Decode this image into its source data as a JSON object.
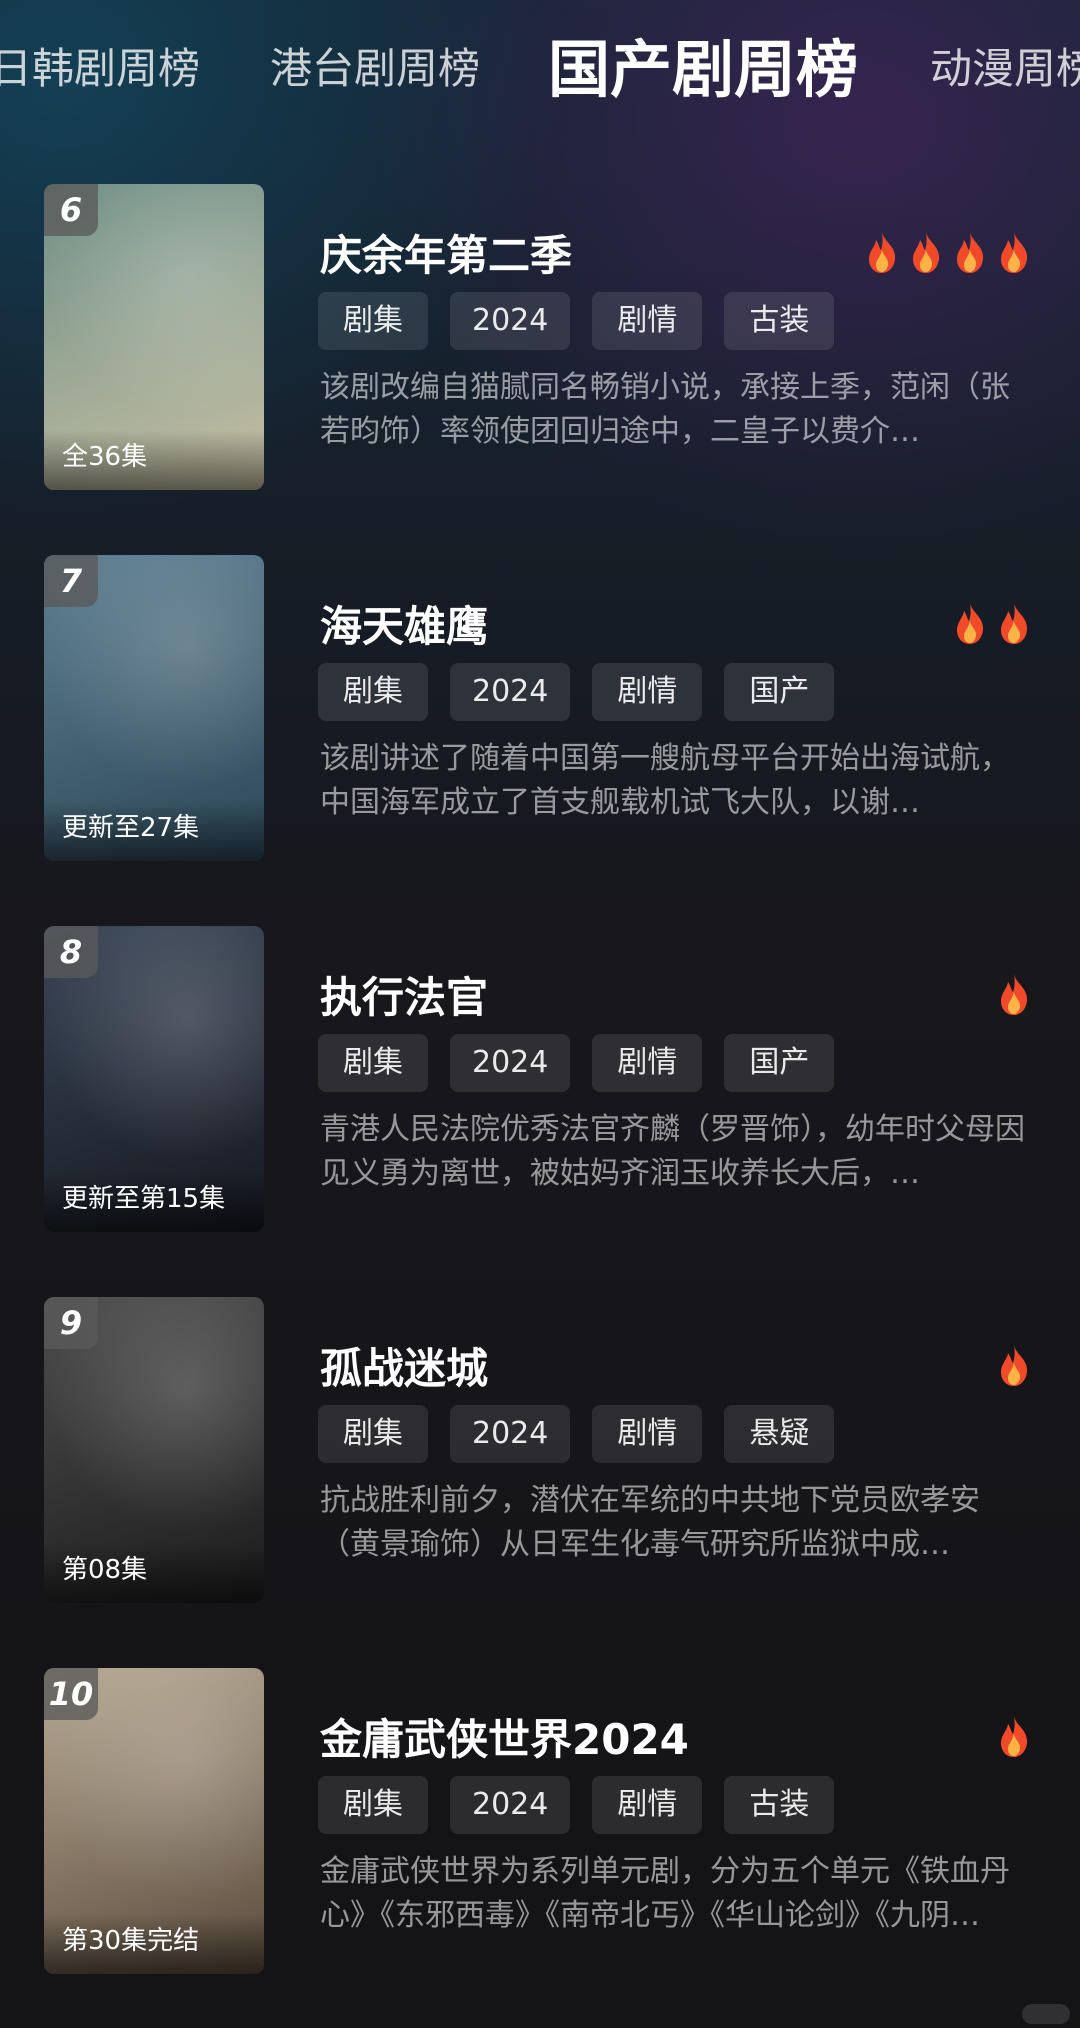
{
  "tabs": [
    {
      "label": "日韩剧周榜",
      "active": false
    },
    {
      "label": "港台剧周榜",
      "active": false
    },
    {
      "label": "国产剧周榜",
      "active": true
    },
    {
      "label": "动漫周榜",
      "active": false
    }
  ],
  "items": [
    {
      "rank": "6",
      "title": "庆余年第二季",
      "episodes": "全36集",
      "heat": 4,
      "tags": [
        "剧集",
        "2024",
        "剧情",
        "古装"
      ],
      "description": "该剧改编自猫腻同名畅销小说，承接上季，范闲（张若昀饰）率领使团回归途中，二皇子以费介…",
      "poster_colors": [
        "#6e8f86",
        "#c7c0a4"
      ]
    },
    {
      "rank": "7",
      "title": "海天雄鹰",
      "episodes": "更新至27集",
      "heat": 2,
      "tags": [
        "剧集",
        "2024",
        "剧情",
        "国产"
      ],
      "description": "该剧讲述了随着中国第一艘航母平台开始出海试航，中国海军成立了首支舰载机试飞大队，以谢…",
      "poster_colors": [
        "#5f8092",
        "#2c4656"
      ]
    },
    {
      "rank": "8",
      "title": "执行法官",
      "episodes": "更新至第15集",
      "heat": 1,
      "tags": [
        "剧集",
        "2024",
        "剧情",
        "国产"
      ],
      "description": "青港人民法院优秀法官齐麟（罗晋饰），幼年时父母因见义勇为离世，被姑妈齐润玉收养长大后，…",
      "poster_colors": [
        "#3a4658",
        "#15181f"
      ]
    },
    {
      "rank": "9",
      "title": "孤战迷城",
      "episodes": "第08集",
      "heat": 1,
      "tags": [
        "剧集",
        "2024",
        "剧情",
        "悬疑"
      ],
      "description": "抗战胜利前夕，潜伏在军统的中共地下党员欧孝安（黄景瑜饰）从日军生化毒气研究所监狱中成…",
      "poster_colors": [
        "#4d4d4d",
        "#1c1c1c"
      ]
    },
    {
      "rank": "10",
      "title": "金庸武侠世界2024",
      "episodes": "第30集完结",
      "heat": 1,
      "tags": [
        "剧集",
        "2024",
        "剧情",
        "古装"
      ],
      "description": "金庸武侠世界为系列单元剧，分为五个单元《铁血丹心》《东邪西毒》《南帝北丐》《华山论剑》《九阴…",
      "poster_colors": [
        "#b7aa93",
        "#5a4a3c"
      ]
    }
  ],
  "colors": {
    "flame_outer": "#f04a2a",
    "flame_inner": "#ffb347"
  },
  "icons": {
    "heat": "flame-icon"
  }
}
